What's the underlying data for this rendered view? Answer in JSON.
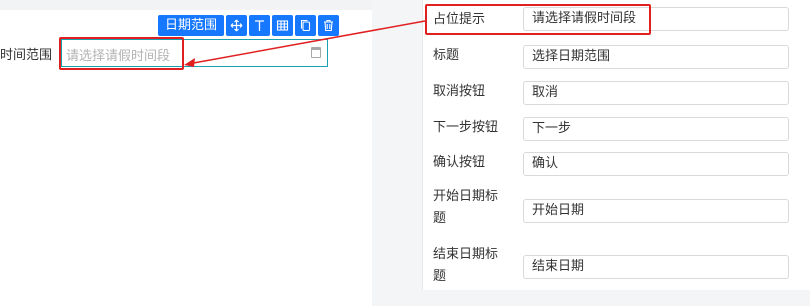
{
  "canvas": {
    "field_label": "时间范围",
    "placeholder": "请选择请假时间段",
    "toolbar": {
      "title": "日期范围",
      "buttons": [
        "move-icon",
        "align-top-icon",
        "table-icon",
        "copy-icon",
        "delete-icon"
      ]
    }
  },
  "properties": {
    "rows": [
      {
        "label": "占位提示",
        "value": "请选择请假时间段"
      },
      {
        "label": "标题",
        "value": "选择日期范围"
      },
      {
        "label": "取消按钮",
        "value": "取消"
      },
      {
        "label": "下一步按钮",
        "value": "下一步"
      },
      {
        "label": "确认按钮",
        "value": "确认"
      },
      {
        "label_line1": "开始日期标",
        "label_line2": "题",
        "value": "开始日期"
      },
      {
        "label_line1": "结束日期标",
        "label_line2": "题",
        "value": "结束日期"
      }
    ]
  },
  "colors": {
    "accent": "#1677ff",
    "highlight": "#e02020",
    "field_border": "#1aa1b1"
  }
}
